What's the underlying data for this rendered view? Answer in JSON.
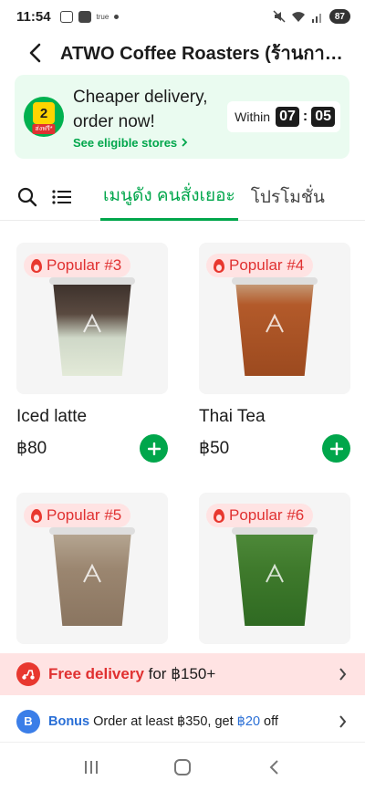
{
  "status_bar": {
    "time": "11:54",
    "carrier_label": "true",
    "battery": "87"
  },
  "header": {
    "title": "ATWO Coffee Roasters (ร้านกาแ..."
  },
  "promo": {
    "title_line1": "Cheaper delivery,",
    "title_line2": "order now!",
    "link_label": "See eligible stores",
    "logo_number": "2",
    "logo_tag": "ส่งฟรี*",
    "timer_label": "Within",
    "timer_minutes": "07",
    "timer_seconds": "05"
  },
  "tabs": {
    "active_label": "เมนูดัง คนสั่งเยอะ",
    "inactive_label": "โปรโมชั่น"
  },
  "products": [
    {
      "badge": "Popular #3",
      "name": "Iced latte",
      "price": "฿80"
    },
    {
      "badge": "Popular #4",
      "name": "Thai Tea",
      "price": "฿50"
    },
    {
      "badge": "Popular #5",
      "name": "",
      "price": ""
    },
    {
      "badge": "Popular #6",
      "name": "",
      "price": ""
    }
  ],
  "free_delivery": {
    "strong": "Free delivery",
    "rest": " for ฿150+"
  },
  "bonus": {
    "strong": "Bonus",
    "text_before": " Order at least ฿350, get ",
    "amount": "฿20",
    "text_after": " off",
    "icon_glyph": "B"
  },
  "colors": {
    "brand_green": "#00a64b",
    "promo_bg": "#eafbf0",
    "badge_red": "#e03131",
    "free_bar_bg": "#ffe3e3",
    "bonus_blue": "#2a6fd6"
  }
}
